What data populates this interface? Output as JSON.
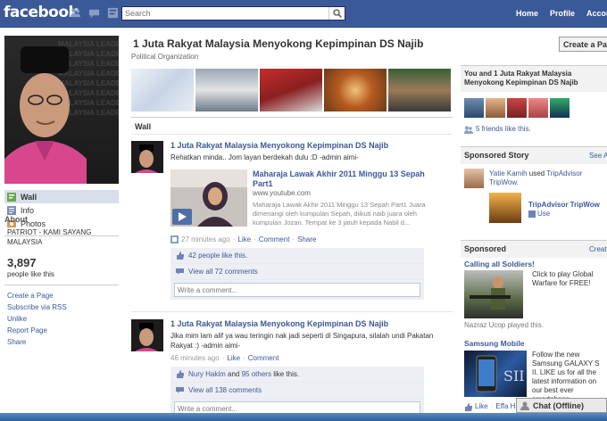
{
  "topbar": {
    "logo": "facebook",
    "search_placeholder": "Search",
    "nav": [
      "Home",
      "Profile",
      "Account"
    ]
  },
  "left": {
    "profile_bg_text": "MALAYSIA LEADER\nMALAYSIA LEADER\nMALAYSIA LEADER\nMALAYSIA LEADER\nMALAYSIA LEADER\nMALAYSIA LEADER\nMALAYSIA LEADER\nMALAYSIA LEADER",
    "nav": [
      {
        "label": "Wall",
        "icon": "wall-icon"
      },
      {
        "label": "Info",
        "icon": "info-icon"
      },
      {
        "label": "Photos",
        "icon": "photos-icon"
      }
    ],
    "about_heading": "About",
    "about_text": "PATRIOT - KAMI SAYANG MALAYSIA",
    "likes_count": "3,897",
    "likes_label": "people like this",
    "links": [
      "Create a Page",
      "Subscribe via RSS",
      "Unlike",
      "Report Page",
      "Share"
    ]
  },
  "main": {
    "title": "1 Juta Rakyat Malaysia Menyokong Kepimpinan DS Najib",
    "category": "Political Organization",
    "wall_tab": "Wall",
    "posts": [
      {
        "actor": "1 Juta Rakyat Malaysia Menyokong Kepimpinan DS Najib",
        "message": "Rehatkan minda.. Jom layan berdekah dulu :D -admin aimi-",
        "attachment": {
          "title": "Maharaja Lawak Akhir 2011 Minggu 13 Sepah Part1",
          "url": "www.youtube.com",
          "description": "Maharaja Lawak Akhir 2011 Minggu 13 Sepah Part1 Juara dimenangi oleh kumpulan Sepah, diikuti naib juara oleh kumpulan Jozan. Tempat ke 3 jatuh kepada Nabil d..."
        },
        "time": "27 minutes ago",
        "actions": [
          "Like",
          "Comment",
          "Share"
        ],
        "likes": "42 people like this.",
        "comments": "View all 72 comments",
        "comment_placeholder": "Write a comment..."
      },
      {
        "actor": "1 Juta Rakyat Malaysia Menyokong Kepimpinan DS Najib",
        "message": "Jika mim lam alif ya wau teringin nak jadi seperti di Singapura, silalah undi Pakatan Rakyat :) -admin aimi-",
        "time": "46 minutes ago",
        "actions": [
          "Like",
          "Comment"
        ],
        "likes_name": "Nury Hakim",
        "likes_and": "and",
        "likes_others": "95 others",
        "likes_tail": "like this.",
        "comments": "View all 138 comments",
        "comment_placeholder": "Write a comment..."
      }
    ]
  },
  "right": {
    "create_page": "Create a Page",
    "friends_header": "You and 1 Juta Rakyat Malaysia Menyokong Kepimpinan DS Najib",
    "friends_like": "5 friends like this.",
    "sponsored_story_heading": "Sponsored Story",
    "see_all": "See All",
    "story_name": "Yatie Kamih",
    "story_used": "used",
    "story_app": "TripAdvisor TripWow.",
    "story_app_title": "TripAdvisor TripWow",
    "story_use": "Use",
    "sponsored_heading": "Sponsored",
    "create_ad": "Create an Ad",
    "ad1_title": "Calling all Soldiers!",
    "ad1_text": "Click to play Global Warfare for FREE!",
    "ad1_footer": "Nazraz Ucop played this.",
    "ad2_title": "Samsung Mobile",
    "ad2_text": "Follow the new Samsung GALAXY S II. LIKE us for all the latest information on our best ever smartphone.",
    "ad2_like": "Like",
    "ad2_footer": "Effa Ha",
    "chat_label": "Chat (Offline)"
  },
  "colors": {
    "brand": "#3b5998",
    "ufi_bg": "#edeff4"
  }
}
